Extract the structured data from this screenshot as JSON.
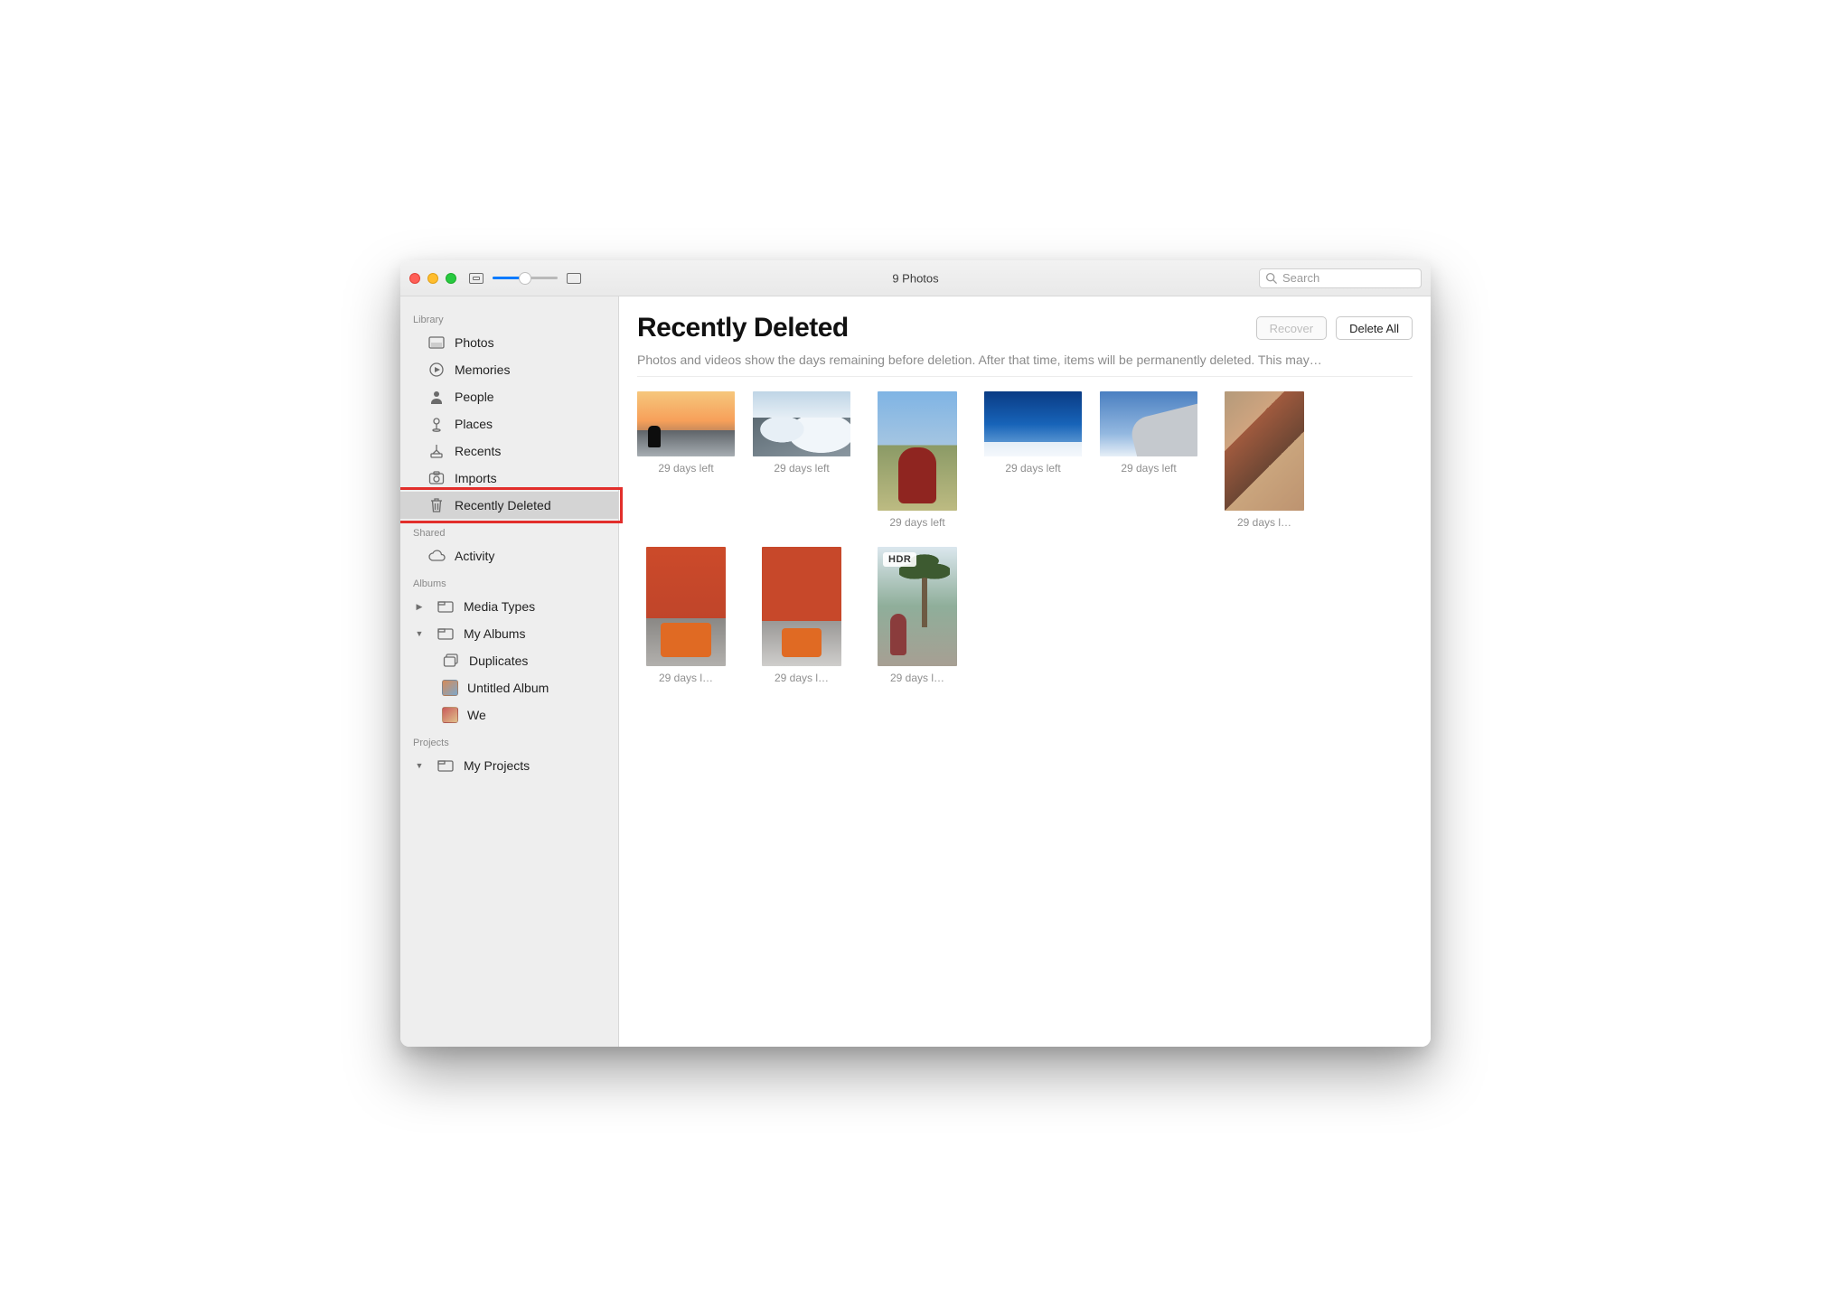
{
  "titlebar": {
    "title": "9 Photos"
  },
  "search": {
    "placeholder": "Search"
  },
  "sidebar": {
    "sections": {
      "library": {
        "label": "Library",
        "items": {
          "photos": {
            "label": "Photos"
          },
          "memories": {
            "label": "Memories"
          },
          "people": {
            "label": "People"
          },
          "places": {
            "label": "Places"
          },
          "recents": {
            "label": "Recents"
          },
          "imports": {
            "label": "Imports"
          },
          "recently_deleted": {
            "label": "Recently Deleted"
          }
        }
      },
      "shared": {
        "label": "Shared",
        "items": {
          "activity": {
            "label": "Activity"
          }
        }
      },
      "albums": {
        "label": "Albums",
        "media_types": {
          "label": "Media Types"
        },
        "my_albums": {
          "label": "My Albums"
        },
        "children": {
          "duplicates": {
            "label": "Duplicates"
          },
          "untitled": {
            "label": "Untitled Album"
          },
          "we": {
            "label": "We"
          }
        }
      },
      "projects": {
        "label": "Projects",
        "my_projects": {
          "label": "My Projects"
        }
      }
    }
  },
  "main": {
    "title": "Recently Deleted",
    "subtext": "Photos and videos show the days remaining before deletion. After that time, items will be permanently deleted. This may…",
    "actions": {
      "recover": {
        "label": "Recover",
        "enabled": false
      },
      "delete_all": {
        "label": "Delete All",
        "enabled": true
      }
    },
    "items": [
      {
        "caption": "29 days left",
        "orient": "landscape",
        "art": "sunset",
        "badge": null
      },
      {
        "caption": "29 days left",
        "orient": "landscape",
        "art": "mountain",
        "badge": null
      },
      {
        "caption": "29 days left",
        "orient": "portrait",
        "art": "vineyard",
        "badge": null
      },
      {
        "caption": "29 days left",
        "orient": "landscape",
        "art": "sky1",
        "badge": null
      },
      {
        "caption": "29 days left",
        "orient": "landscape",
        "art": "wing",
        "badge": null
      },
      {
        "caption": "29 days l…",
        "orient": "portrait",
        "art": "mural",
        "badge": null
      },
      {
        "caption": "29 days l…",
        "orient": "portrait",
        "art": "cafe",
        "badge": null
      },
      {
        "caption": "29 days l…",
        "orient": "portrait",
        "art": "cafe2",
        "badge": null
      },
      {
        "caption": "29 days l…",
        "orient": "portrait",
        "art": "palm",
        "badge": "HDR"
      }
    ]
  }
}
